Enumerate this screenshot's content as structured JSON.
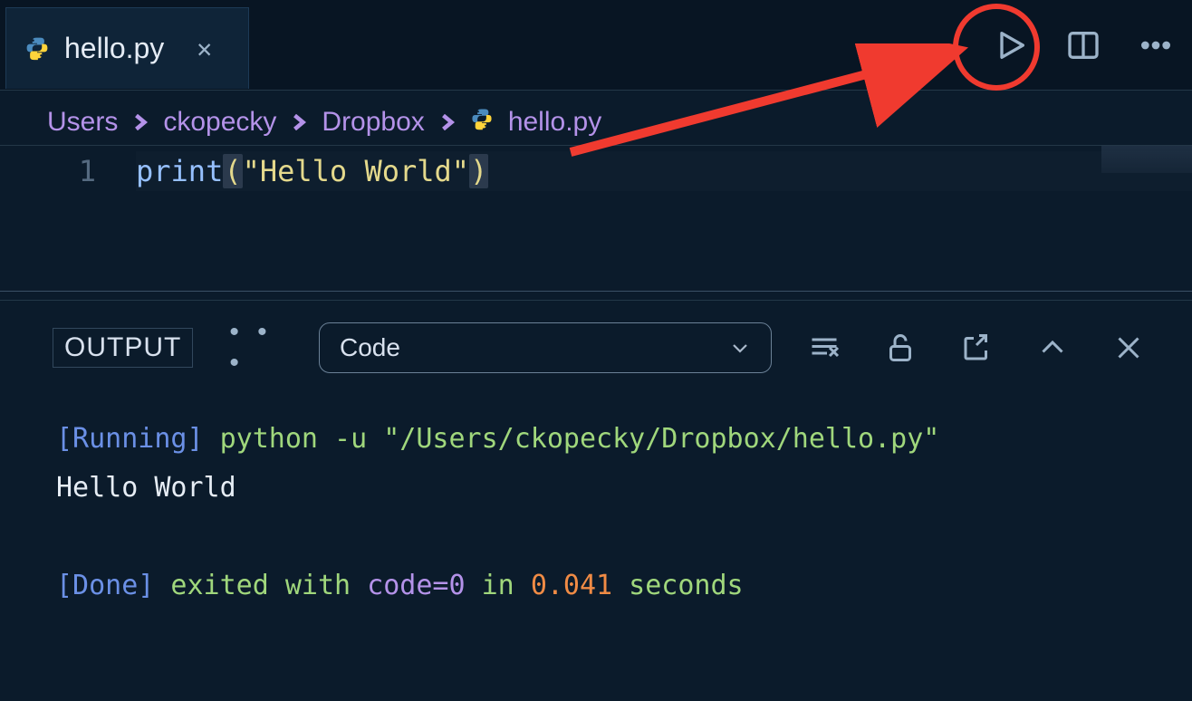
{
  "tab": {
    "filename": "hello.py",
    "close_glyph": "✕"
  },
  "breadcrumb": {
    "segments": [
      "Users",
      "ckopecky",
      "Dropbox"
    ],
    "file": "hello.py"
  },
  "editor": {
    "line_number": "1",
    "fn": "print",
    "lparen": "(",
    "string": "\"Hello World\"",
    "rparen": ")"
  },
  "panel": {
    "tab_label": "OUTPUT",
    "dots": "• • •",
    "select_value": "Code"
  },
  "output": {
    "running_tag": "[Running]",
    "running_cmd": " python -u \"/Users/ckopecky/Dropbox/hello.py\"",
    "stdout": "Hello World",
    "done_tag": "[Done]",
    "done_prefix": " exited with ",
    "done_code_label": "code=",
    "done_code_value": "0",
    "done_in": " in ",
    "done_time": "0.041",
    "done_suffix": " seconds"
  }
}
